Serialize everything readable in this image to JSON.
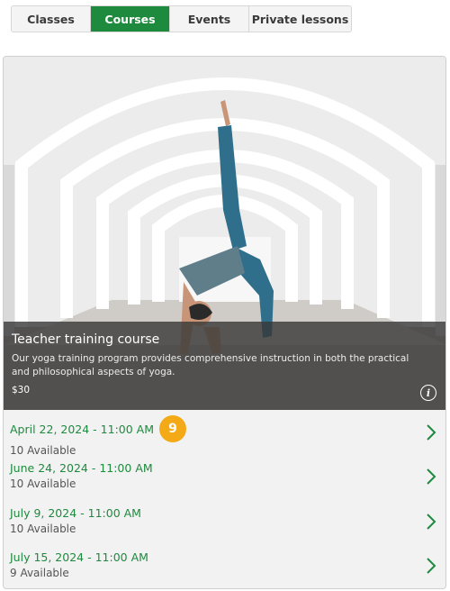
{
  "tabs": [
    {
      "label": "Classes",
      "active": false
    },
    {
      "label": "Courses",
      "active": true
    },
    {
      "label": "Events",
      "active": false
    },
    {
      "label": "Private lessons",
      "active": false
    }
  ],
  "course": {
    "title": "Teacher training course",
    "description": "Our yoga training program provides comprehensive instruction in both the practical and philosophical aspects of yoga.",
    "price": "$30",
    "info_icon": "info-icon"
  },
  "sessions": [
    {
      "date": "April 22, 2024 - 11:00 AM",
      "availability": "10 Available",
      "badge": "9"
    },
    {
      "date": "June 24, 2024 - 11:00 AM",
      "availability": "10 Available"
    },
    {
      "date": "July 9, 2024 - 11:00 AM",
      "availability": "10 Available"
    },
    {
      "date": "July 15, 2024 - 11:00 AM",
      "availability": "9 Available"
    }
  ],
  "colors": {
    "accent": "#1e8a3e",
    "badge": "#f4a917",
    "overlay": "#373737"
  }
}
